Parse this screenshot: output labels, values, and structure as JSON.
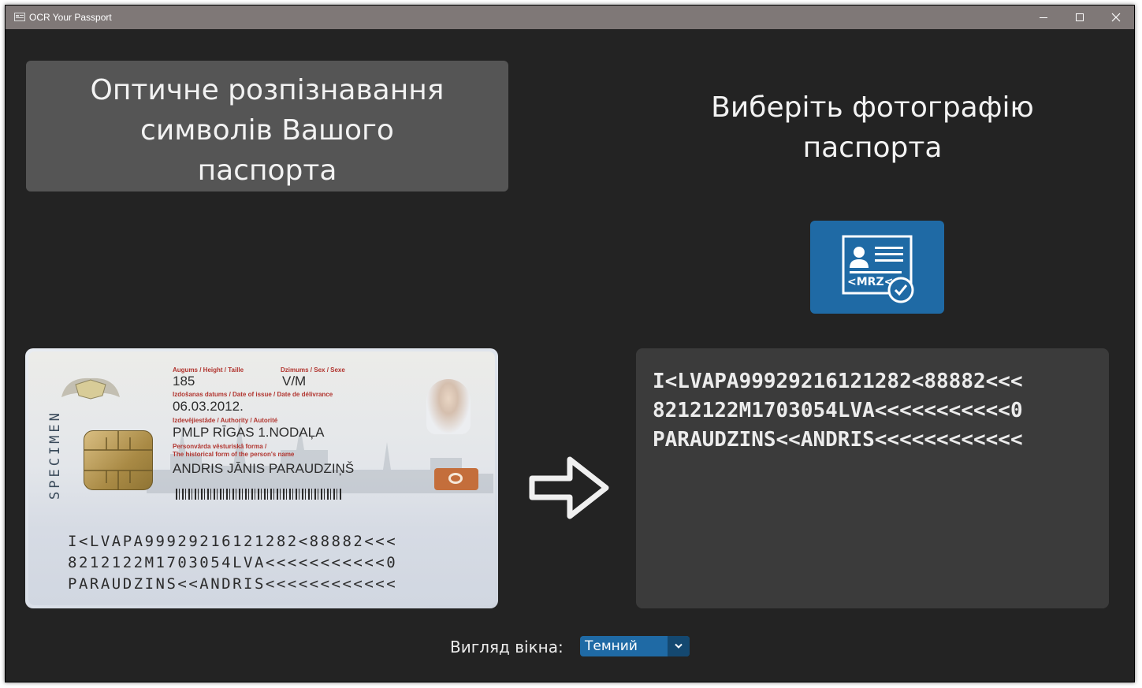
{
  "window": {
    "title": "OCR Your Passport",
    "controls": [
      "minimize-icon",
      "maximize-icon",
      "close-icon"
    ]
  },
  "heading": {
    "line1": "Оптичне розпізнавання",
    "line2": "символів Вашого",
    "line3": "паспорта"
  },
  "choose": {
    "line1": "Виберіть фотографію",
    "line2": "паспорта",
    "button_icon": "id-card-mrz-icon",
    "icon_text": "<MRZ<"
  },
  "card": {
    "specimen": "SPECIMEN",
    "height_label": "Augums / Height / Taille",
    "height_value": "185",
    "sex_label": "Dzimums / Sex / Sexe",
    "sex_value": "V/M",
    "issue_label": "Izdošanas datums / Date of issue / Date de délivrance",
    "issue_value": "06.03.2012.",
    "authority_label": "Izdevējiestāde / Authority / Autorité",
    "authority_value": "PMLP RĪGAS 1.NODAĻA",
    "name_label1": "Personvārda vēsturiskā forma /",
    "name_label2": "The historical form of the person's name",
    "name_value": "ANDRIS JĀNIS PARAUDZIŅŠ",
    "mrz1": "I<LVAPA99929216121282<88882<<<",
    "mrz2": "8212122M1703054LVA<<<<<<<<<<<0",
    "mrz3": "PARAUDZINS<<ANDRIS<<<<<<<<<<<<"
  },
  "result": {
    "line1": "I<LVAPA99929216121282<88882<<<",
    "line2": "8212122M1703054LVA<<<<<<<<<<<0",
    "line3": "PARAUDZINS<<ANDRIS<<<<<<<<<<<<"
  },
  "appearance": {
    "label": "Вигляд вікна:",
    "selected": "Темний"
  },
  "colors": {
    "background": "#232323",
    "accent": "#1f6aa5",
    "titlebar": "#7f7877",
    "panel": "#555555",
    "result_panel": "#3b3b3b"
  }
}
